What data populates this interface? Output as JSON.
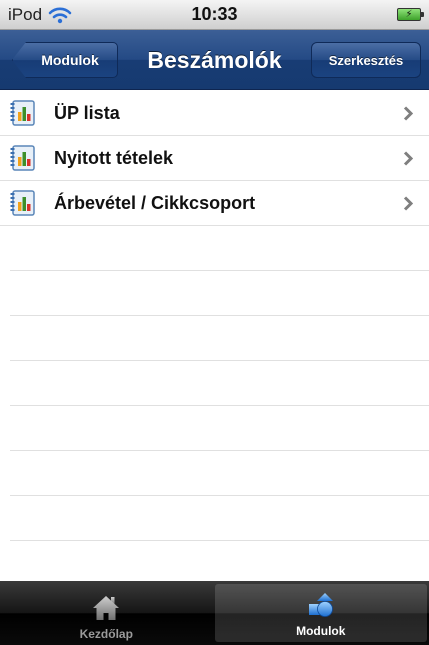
{
  "status_bar": {
    "carrier": "iPod",
    "time": "10:33"
  },
  "nav_bar": {
    "back_label": "Modulok",
    "title": "Beszámolók",
    "edit_label": "Szerkesztés"
  },
  "list": {
    "items": [
      {
        "label": "ÜP lista",
        "icon": "report-chart-icon"
      },
      {
        "label": "Nyitott tételek",
        "icon": "report-chart-icon"
      },
      {
        "label": "Árbevétel / Cikkcsoport",
        "icon": "report-chart-icon"
      }
    ]
  },
  "tab_bar": {
    "tabs": [
      {
        "label": "Kezdőlap",
        "icon": "home-icon",
        "selected": false
      },
      {
        "label": "Modulok",
        "icon": "modules-icon",
        "selected": true
      }
    ]
  },
  "colors": {
    "nav_blue": "#244a85",
    "tab_bar_black": "#000000"
  }
}
